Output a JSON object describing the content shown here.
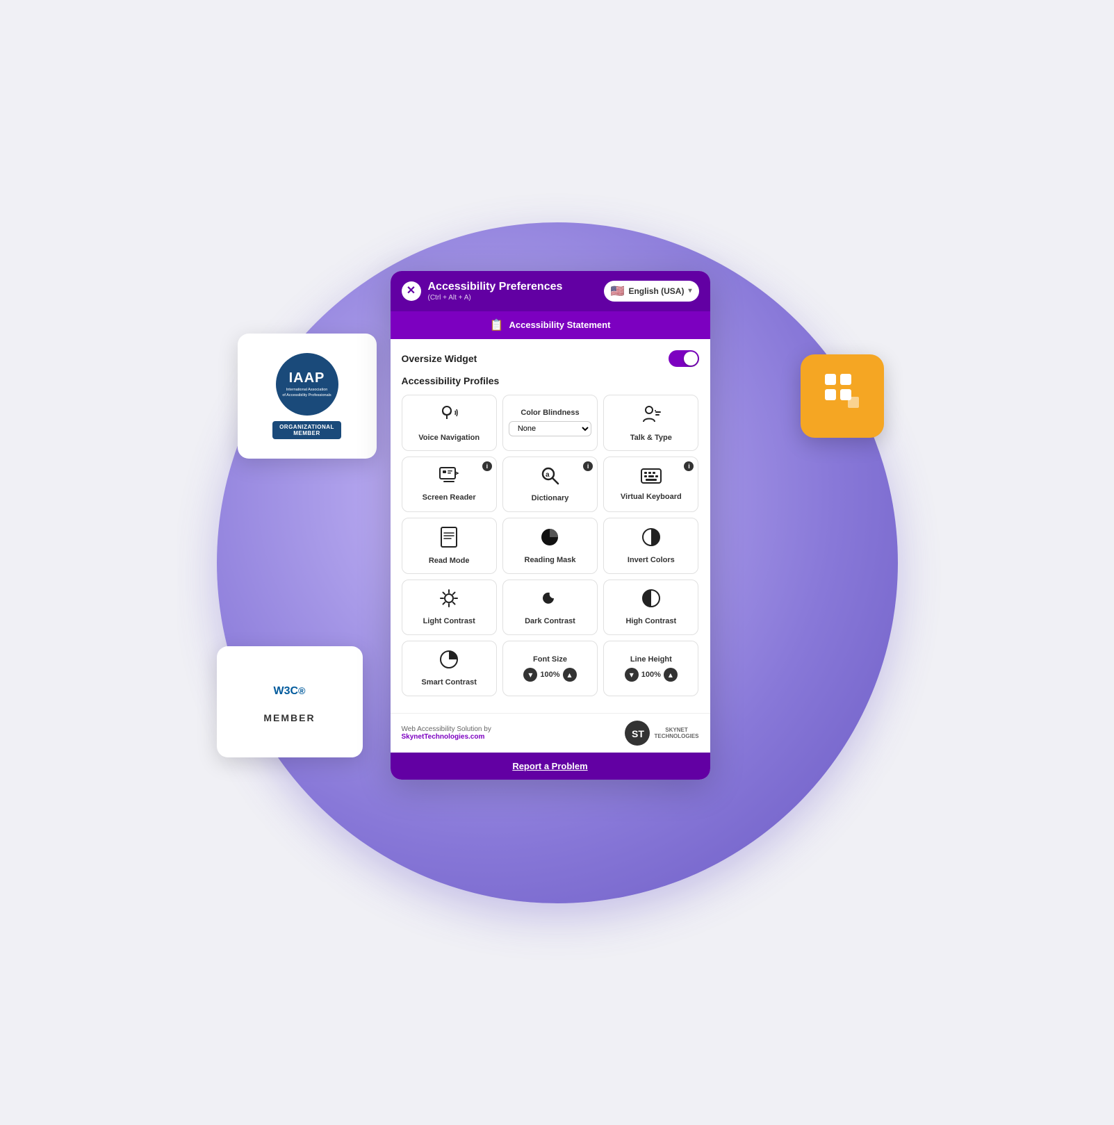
{
  "panel": {
    "title": "Accessibility Preferences",
    "subtitle": "(Ctrl + Alt + A)",
    "close_label": "×",
    "lang_selector": "English (USA)",
    "statement_bar": "Accessibility Statement",
    "oversize_widget_label": "Oversize Widget",
    "profiles_label": "Accessibility Profiles",
    "options": [
      {
        "id": "voice-navigation",
        "label": "Voice Navigation",
        "icon": "🎙",
        "has_info": false
      },
      {
        "id": "color-blindness",
        "label": "Color Blindness",
        "icon": null,
        "has_info": false,
        "special": "select",
        "select_options": [
          "None"
        ]
      },
      {
        "id": "talk-and-type",
        "label": "Talk & Type",
        "icon": "🗣",
        "has_info": false
      },
      {
        "id": "screen-reader",
        "label": "Screen Reader",
        "icon": "📺",
        "has_info": true
      },
      {
        "id": "dictionary",
        "label": "Dictionary",
        "icon": "🔍",
        "has_info": true
      },
      {
        "id": "virtual-keyboard",
        "label": "Virtual Keyboard",
        "icon": "⌨",
        "has_info": true
      },
      {
        "id": "read-mode",
        "label": "Read Mode",
        "icon": "📄",
        "has_info": false
      },
      {
        "id": "reading-mask",
        "label": "Reading Mask",
        "icon": "🌑",
        "has_info": false
      },
      {
        "id": "invert-colors",
        "label": "Invert Colors",
        "icon": "◑",
        "has_info": false
      },
      {
        "id": "light-contrast",
        "label": "Light Contrast",
        "icon": "✦",
        "has_info": false
      },
      {
        "id": "dark-contrast",
        "label": "Dark Contrast",
        "icon": "🌙",
        "has_info": false
      },
      {
        "id": "high-contrast",
        "label": "High Contrast",
        "icon": "◐",
        "has_info": false
      },
      {
        "id": "smart-contrast",
        "label": "Smart Contrast",
        "icon": "◑",
        "has_info": false
      },
      {
        "id": "font-size",
        "label": "Font Size",
        "icon": null,
        "has_info": false,
        "special": "size",
        "value": "100%"
      },
      {
        "id": "line-height",
        "label": "Line Height",
        "icon": null,
        "has_info": false,
        "special": "size",
        "value": "100%"
      }
    ],
    "footer": {
      "line1": "Web Accessibility Solution by",
      "line2": "SkynetTechnologies.com",
      "logo_text": "ST",
      "logo_sub": "SKYNET\nTECHNOLOGIES"
    },
    "report_btn": "Report a Problem"
  },
  "iaap": {
    "title": "IAAP",
    "sub": "International Association\nof Accessibility Professionals",
    "badge": "ORGANIZATIONAL\nMEMBER"
  },
  "w3c": {
    "title": "W3C",
    "sup": "®",
    "member": "MEMBER"
  }
}
